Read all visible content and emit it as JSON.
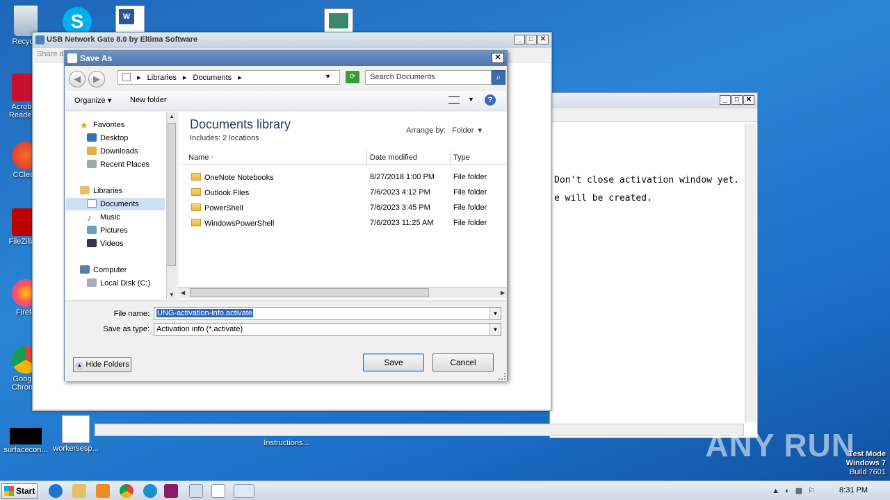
{
  "desktop": {
    "icons": [
      {
        "label": "Recycle",
        "icon": "recycle-bin-icon"
      },
      {
        "label": "Acrob Reader",
        "icon": "acrobat-icon"
      },
      {
        "label": "CClean",
        "icon": "ccleaner-icon"
      },
      {
        "label": "FileZilla C",
        "icon": "filezilla-icon"
      },
      {
        "label": "Firefo",
        "icon": "firefox-icon"
      },
      {
        "label": "Goog Chron",
        "icon": "chrome-icon"
      },
      {
        "label": "surfacecon...",
        "icon": "file-icon"
      },
      {
        "label": "workersesp...",
        "icon": "word-doc-icon"
      },
      {
        "label": "Instructions...",
        "icon": "file-icon"
      }
    ]
  },
  "console": {
    "line1": "Don't close activation window yet.",
    "line2": "e will be created."
  },
  "usb_window": {
    "title": "USB Network Gate 8.0 by Eltima Software",
    "subtitle": "Share d"
  },
  "dialog": {
    "title": "Save As",
    "breadcrumb": [
      "Libraries",
      "Documents"
    ],
    "search_placeholder": "Search Documents",
    "toolbar": {
      "organize": "Organize",
      "new_folder": "New folder"
    },
    "nav": {
      "favorites": "Favorites",
      "desktop": "Desktop",
      "downloads": "Downloads",
      "recent_places": "Recent Places",
      "libraries": "Libraries",
      "documents": "Documents",
      "music": "Music",
      "pictures": "Pictures",
      "videos": "Videos",
      "computer": "Computer",
      "local_disk": "Local Disk (C:)"
    },
    "library_title": "Documents library",
    "library_includes": "Includes:  2 locations",
    "arrange_by_label": "Arrange by:",
    "arrange_by_value": "Folder",
    "columns": {
      "name": "Name",
      "date": "Date modified",
      "type": "Type"
    },
    "files": [
      {
        "name": "OneNote Notebooks",
        "date": "8/27/2018 1:00 PM",
        "type": "File folder"
      },
      {
        "name": "Outlook Files",
        "date": "7/6/2023 4:12 PM",
        "type": "File folder"
      },
      {
        "name": "PowerShell",
        "date": "7/6/2023 3:45 PM",
        "type": "File folder"
      },
      {
        "name": "WindowsPowerShell",
        "date": "7/6/2023 11:25 AM",
        "type": "File folder"
      }
    ],
    "file_name_label": "File name:",
    "file_name_value": "UNG-activation-info.activate",
    "save_type_label": "Save as type:",
    "save_type_value": "Activation info (*.activate)",
    "hide_folders": "Hide Folders",
    "save": "Save",
    "cancel": "Cancel"
  },
  "taskbar": {
    "start": "Start",
    "time": "8:31 PM"
  },
  "watermark": "ANY RUN",
  "system_notice": {
    "line1": "Test Mode",
    "line2": "Windows 7",
    "line3": "Build 7601"
  }
}
